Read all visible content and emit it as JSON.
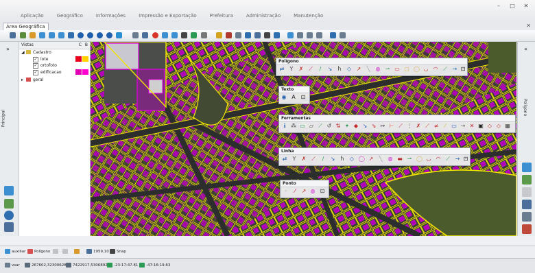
{
  "menu": {
    "items": [
      "Aplicação",
      "Geográfico",
      "Informações",
      "Impressão e Exportação",
      "Prefeitura",
      "Administração",
      "Manutenção"
    ],
    "minimize": "–",
    "maximize": "□",
    "close": "✕"
  },
  "tabs": {
    "active": "Área Geográfica",
    "close": "✕"
  },
  "left_strip": {
    "collapse": "»",
    "label": "Principal"
  },
  "right_strip": {
    "collapse": "«",
    "label": "Polígono"
  },
  "layers": {
    "header": "Vistas",
    "col_c": "C",
    "col_b": "B",
    "groups": [
      {
        "name": "Cadastro",
        "expanded": true,
        "children": [
          {
            "name": "lote",
            "checked": true,
            "c_color": "#e8001c",
            "b_color": "#ffd200"
          },
          {
            "name": "ortofoto",
            "checked": true
          },
          {
            "name": "edificacao",
            "checked": true,
            "c_color": "#e400b4",
            "b_color": "#ff00d0"
          }
        ]
      },
      {
        "name": "geral",
        "expanded": false,
        "children": []
      }
    ]
  },
  "floating_toolbars": [
    {
      "title": "Polígono"
    },
    {
      "title": "Texto"
    },
    {
      "title": "Ferramentas"
    },
    {
      "title": "Linha"
    },
    {
      "title": "Ponto"
    }
  ],
  "bottom": {
    "layer": "auxiliar",
    "shape": "Polígono",
    "scale": "1959,10",
    "snap": "Snap"
  },
  "status": {
    "user": "vsar",
    "coord_x": "267602,323006288",
    "coord_y": "7422917,53068922",
    "lat": "-23:17:47.81",
    "lon": "-47:16:19.63"
  },
  "colors": {
    "parcel": "#f2e600",
    "building": "#d400d4",
    "accent": "#2f6fb0"
  }
}
